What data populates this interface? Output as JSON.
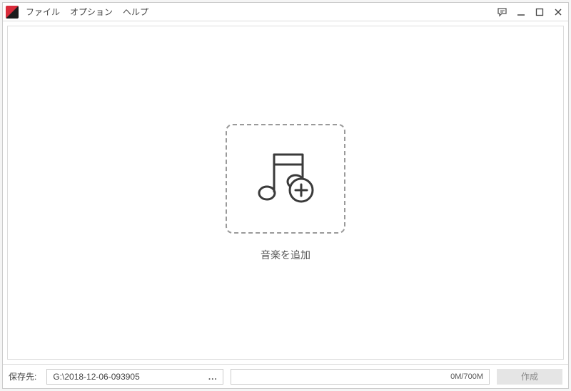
{
  "menu": {
    "file": "ファイル",
    "options": "オプション",
    "help": "ヘルプ"
  },
  "main": {
    "add_music_label": "音楽を追加"
  },
  "bottom": {
    "save_to_label": "保存先:",
    "save_path": "G:\\2018-12-06-093905",
    "browse_ellipsis": "...",
    "progress_text": "0M/700M",
    "create_label": "作成"
  }
}
